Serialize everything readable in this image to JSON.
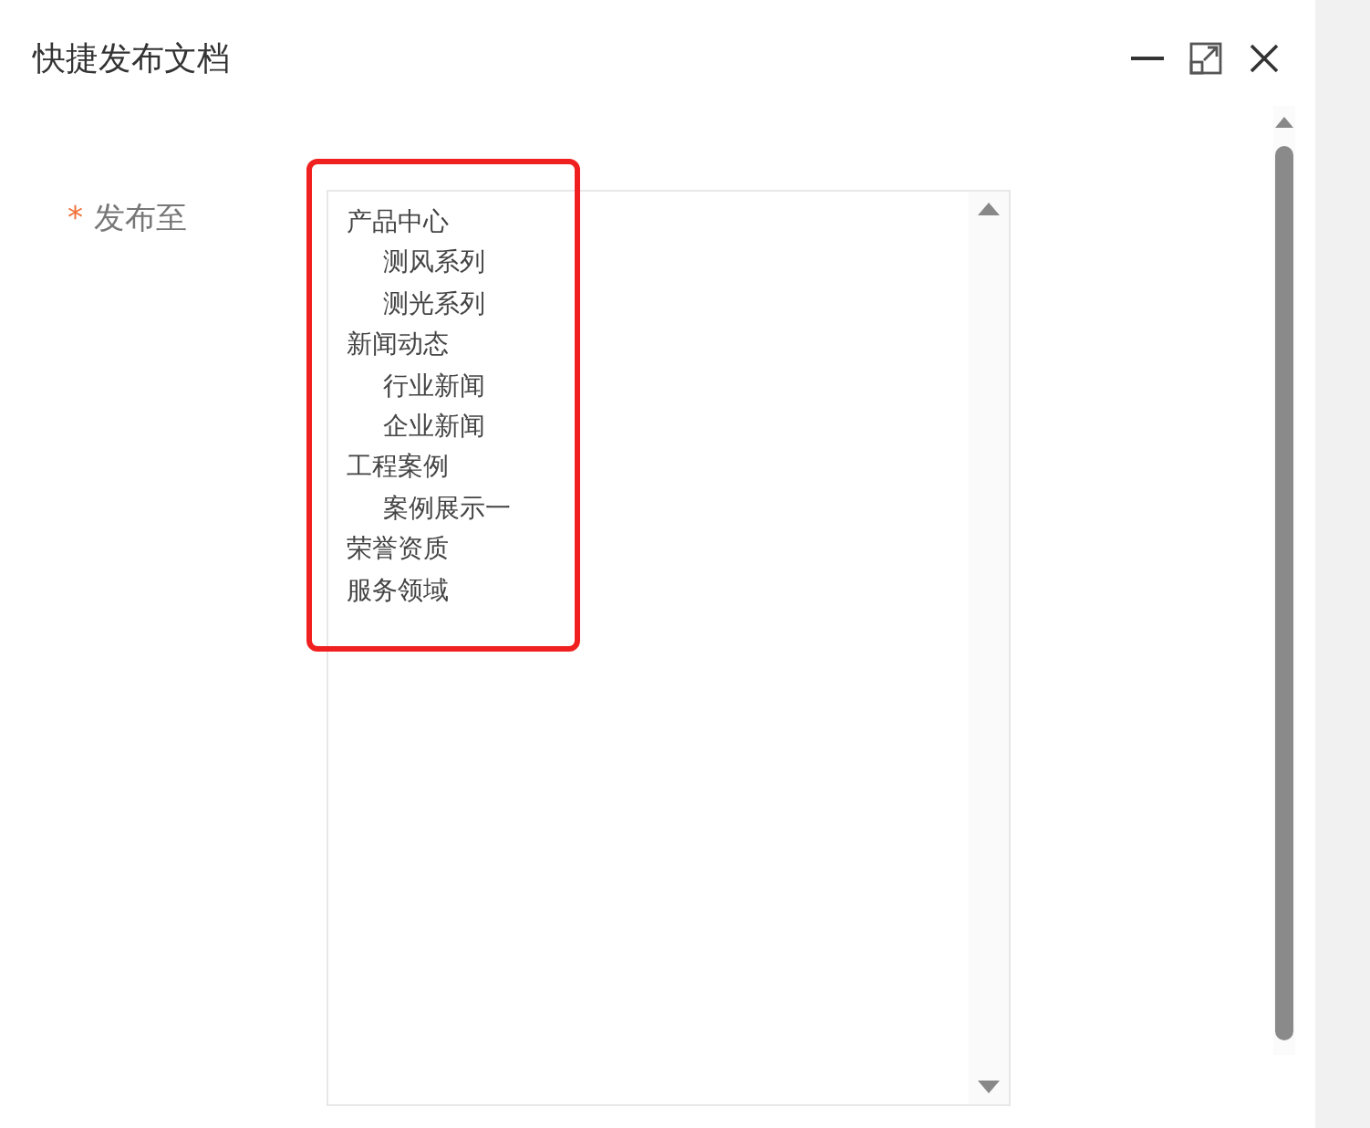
{
  "window": {
    "title": "快捷发布文档"
  },
  "field": {
    "label": "发布至",
    "required_mark": "*",
    "options": [
      {
        "label": "产品中心",
        "children": [
          {
            "label": "测风系列"
          },
          {
            "label": "测光系列"
          }
        ]
      },
      {
        "label": "新闻动态",
        "children": [
          {
            "label": "行业新闻"
          },
          {
            "label": "企业新闻"
          }
        ]
      },
      {
        "label": "工程案例",
        "children": [
          {
            "label": "案例展示一"
          }
        ]
      },
      {
        "label": "荣誉资质"
      },
      {
        "label": "服务领域"
      }
    ]
  }
}
